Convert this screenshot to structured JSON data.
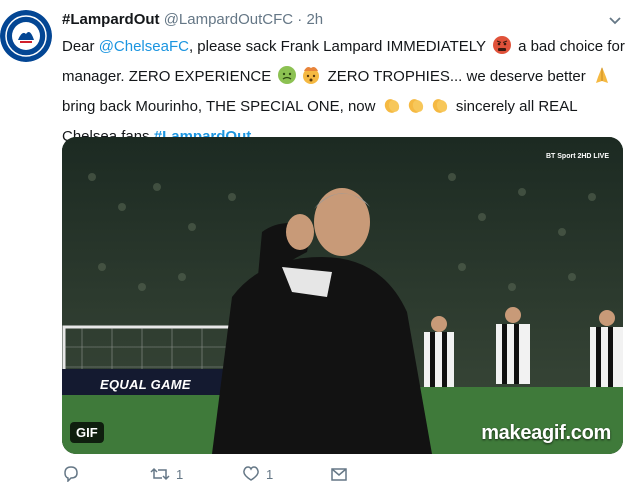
{
  "tweet": {
    "display_name": "#LampardOut",
    "handle": "@LampardOutCFC",
    "separator": "·",
    "time": "2h",
    "text": {
      "line1_a": "Dear ",
      "mention": "@ChelseaFC",
      "line1_b": ", please sack Frank Lampard IMMEDIATELY",
      "line1_c": " a bad choice for manager. ZERO EXPERIENCE",
      "line2_b": " ZERO TROPHIES... we deserve better",
      "line3_a": " bring back Mourinho, THE SPECIAL ONE, now",
      "line3_b": " sincerely all REAL Chelsea fans ",
      "hashtag": "#LampardOut"
    }
  },
  "media": {
    "badge": "GIF",
    "watermark": "makeagif.com",
    "broadcaster": "BT Sport 2HD LIVE",
    "board_text": "EQUAL GAME"
  },
  "actions": {
    "reply_count": "",
    "retweet_count": "1",
    "like_count": "1"
  },
  "icons": {
    "avatar": "chelsea-crest",
    "chevron": "chevron-down-icon",
    "reply": "reply-icon",
    "retweet": "retweet-icon",
    "like": "heart-icon",
    "share": "share-icon"
  },
  "colors": {
    "link": "#1b95e0",
    "text": "#14171a",
    "muted": "#657786",
    "chelsea_blue": "#034694"
  }
}
